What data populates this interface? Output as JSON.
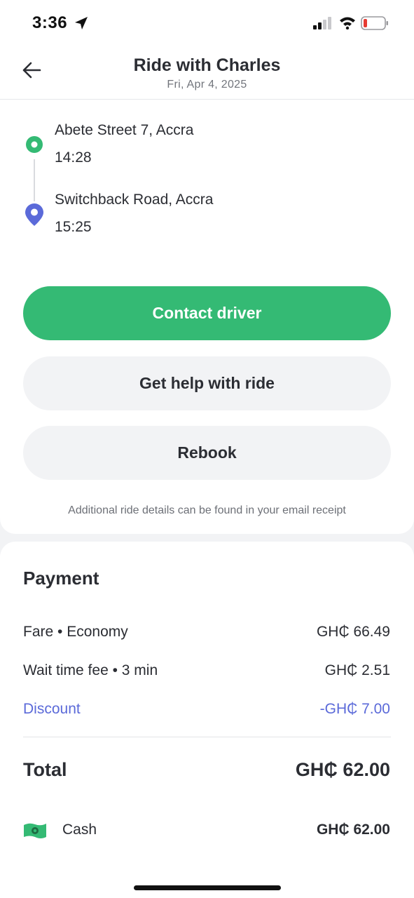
{
  "status_bar": {
    "time": "3:36"
  },
  "header": {
    "title": "Ride with Charles",
    "date": "Fri, Apr 4, 2025"
  },
  "route": {
    "pickup": {
      "address": "Abete Street 7, Accra",
      "time": "14:28"
    },
    "dropoff": {
      "address": "Switchback Road, Accra",
      "time": "15:25"
    }
  },
  "actions": {
    "contact_driver": "Contact driver",
    "get_help": "Get help with ride",
    "rebook": "Rebook"
  },
  "footnote": "Additional ride details can be found in your email receipt",
  "payment": {
    "title": "Payment",
    "items": [
      {
        "label": "Fare • Economy",
        "value": "GH₵ 66.49"
      },
      {
        "label": "Wait time fee • 3 min",
        "value": "GH₵ 2.51"
      },
      {
        "label": "Discount",
        "value": "-GH₵ 7.00"
      }
    ],
    "total_label": "Total",
    "total_value": "GH₵ 62.00",
    "method_label": "Cash",
    "method_value": "GH₵ 62.00"
  },
  "colors": {
    "accent_green": "#34ba74",
    "discount_blue": "#5b6ad9",
    "pin_purple": "#5b6ad9"
  },
  "icons": [
    "location-arrow-icon",
    "signal-icon",
    "wifi-icon",
    "battery-icon",
    "back-arrow-icon",
    "pickup-dot-icon",
    "dropoff-pin-icon",
    "cash-icon"
  ]
}
